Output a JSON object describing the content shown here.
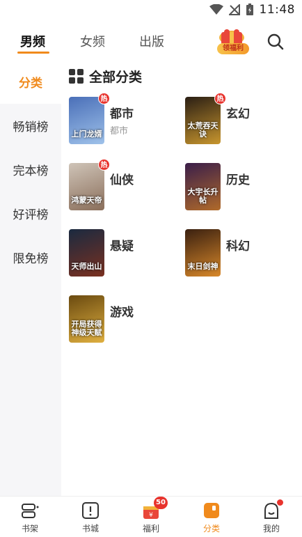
{
  "status_bar": {
    "time": "11:48"
  },
  "top_tabs": [
    {
      "label": "男频"
    },
    {
      "label": "女频"
    },
    {
      "label": "出版"
    }
  ],
  "bonus_badge": {
    "label": "领福利"
  },
  "sidebar": {
    "items": [
      {
        "label": "分类"
      },
      {
        "label": "畅销榜"
      },
      {
        "label": "完本榜"
      },
      {
        "label": "好评榜"
      },
      {
        "label": "限免榜"
      }
    ]
  },
  "section": {
    "title": "全部分类"
  },
  "hot_label": "热",
  "categories": [
    {
      "name": "都市",
      "subtitle": "都市",
      "cover_text": "上门龙婿",
      "hot": true,
      "colors": [
        "#4a6fb8",
        "#9fc2ea"
      ]
    },
    {
      "name": "玄幻",
      "cover_text": "太荒吞天诀",
      "hot": true,
      "colors": [
        "#2a1e14",
        "#c8962e"
      ]
    },
    {
      "name": "仙侠",
      "cover_text": "鸿蒙天帝",
      "hot": true,
      "colors": [
        "#cfc4b8",
        "#8a6e5a"
      ]
    },
    {
      "name": "历史",
      "cover_text": "大宇长升帖",
      "hot": false,
      "colors": [
        "#3a1e4a",
        "#b06a2a"
      ]
    },
    {
      "name": "悬疑",
      "cover_text": "天师出山",
      "hot": false,
      "colors": [
        "#1a2a40",
        "#7a3020"
      ]
    },
    {
      "name": "科幻",
      "cover_text": "末日剑神",
      "hot": false,
      "colors": [
        "#3a2010",
        "#d8882a"
      ]
    },
    {
      "name": "游戏",
      "cover_text": "开局获得神级天赋",
      "hot": false,
      "colors": [
        "#6a4a10",
        "#e0b040"
      ]
    }
  ],
  "bottom_nav": [
    {
      "label": "书架",
      "icon": "bookshelf-icon"
    },
    {
      "label": "书城",
      "icon": "bookstore-icon"
    },
    {
      "label": "福利",
      "icon": "gift-icon",
      "badge": "50"
    },
    {
      "label": "分类",
      "icon": "category-icon"
    },
    {
      "label": "我的",
      "icon": "profile-icon"
    }
  ],
  "colors": {
    "accent": "#f08a1c",
    "hot_red": "#e8332d",
    "sidebar_bg": "#f6f6f8"
  }
}
